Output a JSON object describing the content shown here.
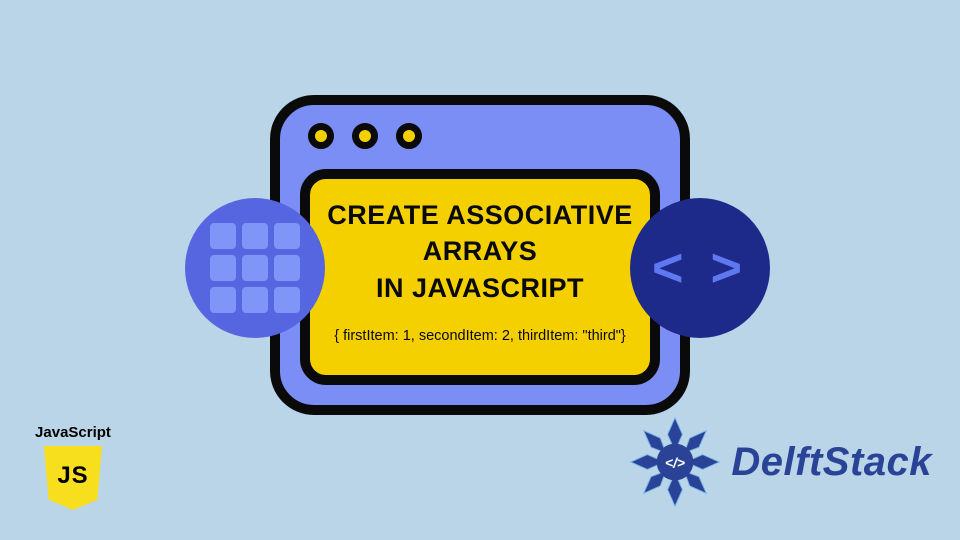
{
  "window": {
    "headline_line1": "Create Associative Arrays",
    "headline_line2": "in JavaScript",
    "code_sample": "{ firstItem: 1, secondItem: 2, thirdItem: \"third\"}"
  },
  "badges": {
    "left_icon": "grid-icon",
    "right_icon": "code-brackets-icon",
    "right_glyph": "< >"
  },
  "js_badge": {
    "label": "JavaScript",
    "shield_text": "JS"
  },
  "delftstack": {
    "brand": "DelftStack",
    "inner_glyph": "</>"
  },
  "colors": {
    "page_bg": "#bad4e8",
    "window_bg": "#7b8ef5",
    "panel_bg": "#f5d000",
    "stroke": "#0a0a0a",
    "badge_left": "#5566e0",
    "badge_right": "#1e2a8a",
    "js_yellow": "#f7df1e",
    "delft_blue": "#2a4396"
  }
}
